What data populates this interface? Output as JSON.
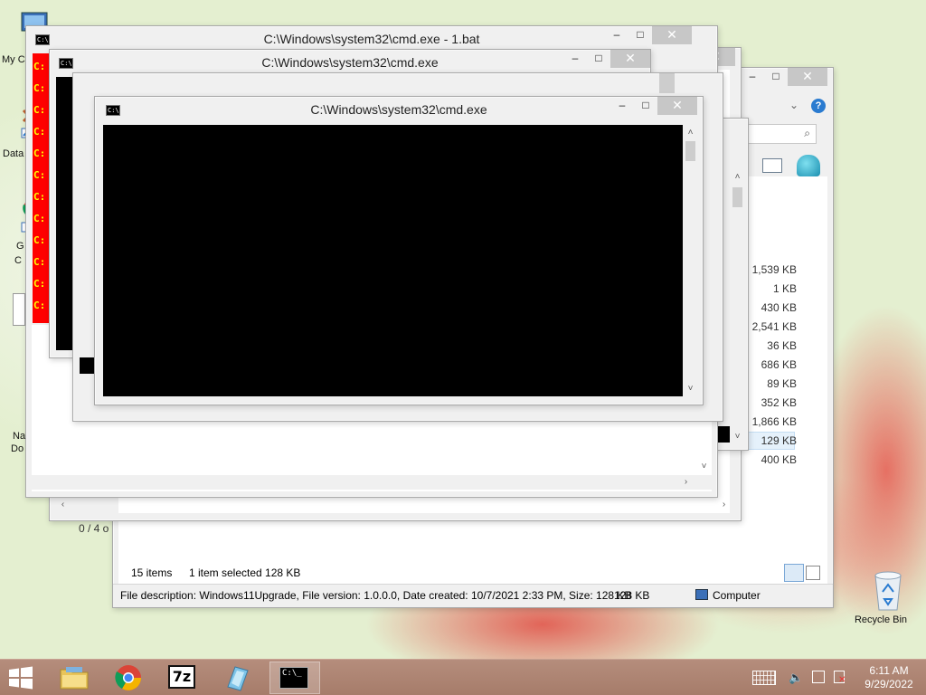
{
  "desktop": {
    "icons": [
      {
        "label": "My C",
        "icon": "computer-icon"
      },
      {
        "label": "Data",
        "icon": "shortcut-icon"
      },
      {
        "label": "G",
        "icon": "chrome-shortcut-icon"
      },
      {
        "label": "C",
        "icon": "chrome-shortcut-icon"
      },
      {
        "label": "Na",
        "icon": "document-icon"
      },
      {
        "label": "Do",
        "icon": "document-icon"
      }
    ],
    "recycle_bin": {
      "label": "Recycle Bin",
      "icon": "recycle-bin-icon"
    }
  },
  "windows": {
    "cmd1": {
      "title": "C:\\Windows\\system32\\cmd.exe - 1.bat",
      "lines": [
        "C:",
        "C:",
        "C:",
        "C:",
        "C:",
        "C:",
        "C:",
        "C:",
        "C:",
        "C:",
        "C:",
        "C:"
      ]
    },
    "cmd2": {
      "title": "C:\\Windows\\system32\\cmd.exe"
    },
    "cmd3": {
      "title": "C:\\Windows\\system32\\cmd.exe"
    },
    "behind": {
      "status_fragment": "0 / 4 o"
    },
    "explorer": {
      "sizes": [
        "1,539 KB",
        "1 KB",
        "430 KB",
        "2,541 KB",
        "36 KB",
        "686 KB",
        "89 KB",
        "352 KB",
        "1,866 KB",
        "129 KB",
        "400 KB"
      ],
      "selected_index": 9,
      "status": {
        "items": "15 items",
        "selected": "1 item selected  128 KB"
      },
      "details_bar": {
        "description": "File description: Windows11Upgrade, File version: 1.0.0.0, Date created: 10/7/2021 2:33 PM, Size: 128 KB",
        "size": "128 KB",
        "location": "Computer"
      }
    }
  },
  "taskbar": {
    "apps": [
      {
        "name": "file-explorer",
        "icon": "folder-icon"
      },
      {
        "name": "chrome",
        "icon": "chrome-icon"
      },
      {
        "name": "7zip",
        "icon": "7zip-icon",
        "label": "7z"
      },
      {
        "name": "app",
        "icon": "app-icon"
      },
      {
        "name": "cmd",
        "icon": "cmd-icon",
        "active": true
      }
    ],
    "clock": {
      "time": "6:11 AM",
      "date": "9/29/2022"
    }
  },
  "colors": {
    "console_bg": "#000000",
    "batch_bg": "#ff0000",
    "batch_text": "#ffff00",
    "taskbar": "#a67c6a",
    "accent_blue": "#2a7bd0"
  }
}
